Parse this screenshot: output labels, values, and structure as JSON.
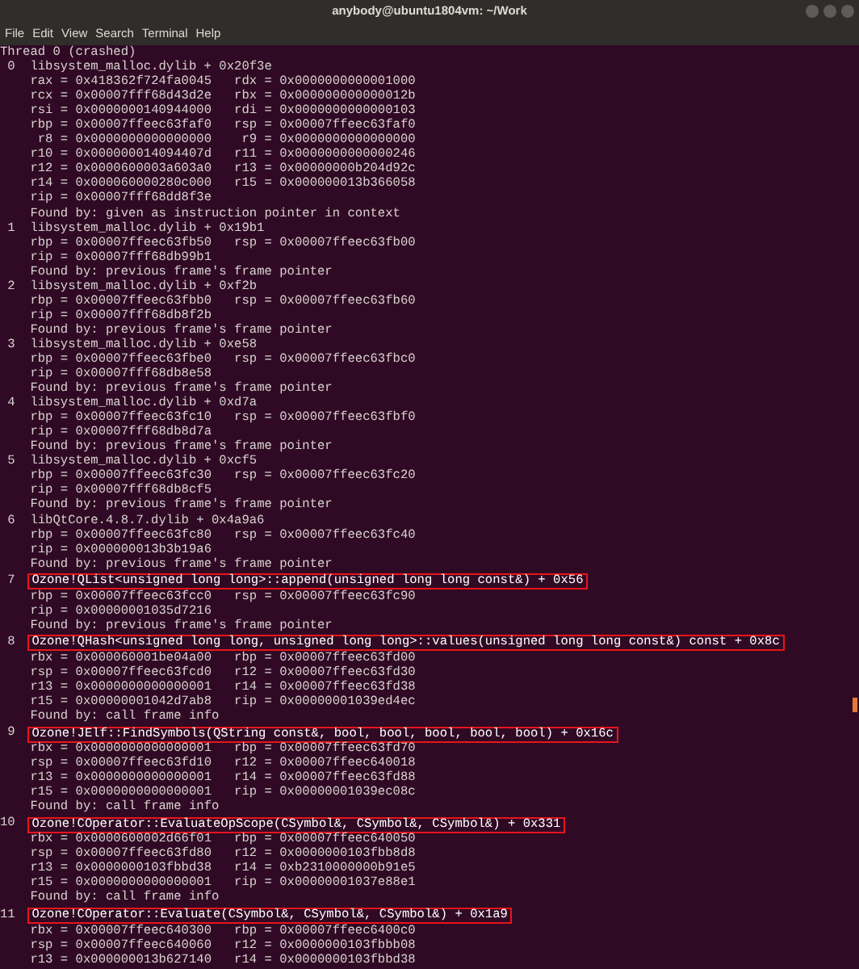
{
  "window": {
    "title": "anybody@ubuntu1804vm: ~/Work"
  },
  "menu": [
    "File",
    "Edit",
    "View",
    "Search",
    "Terminal",
    "Help"
  ],
  "lines": [
    {
      "kind": "plain",
      "text": "Thread 0 (crashed)"
    },
    {
      "kind": "frame",
      "number": "0",
      "text": "libsystem_malloc.dylib + 0x20f3e",
      "highlighted": false
    },
    {
      "kind": "detail",
      "text": "rax = 0x418362f724fa0045   rdx = 0x0000000000001000"
    },
    {
      "kind": "detail",
      "text": "rcx = 0x00007fff68d43d2e   rbx = 0x000000000000012b"
    },
    {
      "kind": "detail",
      "text": "rsi = 0x0000000140944000   rdi = 0x0000000000000103"
    },
    {
      "kind": "detail",
      "text": "rbp = 0x00007ffeec63faf0   rsp = 0x00007ffeec63faf0"
    },
    {
      "kind": "detail",
      "text": " r8 = 0x0000000000000000    r9 = 0x0000000000000000"
    },
    {
      "kind": "detail",
      "text": "r10 = 0x000000014094407d   r11 = 0x0000000000000246"
    },
    {
      "kind": "detail",
      "text": "r12 = 0x0000600003a603a0   r13 = 0x00000000b204d92c"
    },
    {
      "kind": "detail",
      "text": "r14 = 0x000060000280c000   r15 = 0x000000013b366058"
    },
    {
      "kind": "detail",
      "text": "rip = 0x00007fff68dd8f3e"
    },
    {
      "kind": "detail",
      "text": "Found by: given as instruction pointer in context"
    },
    {
      "kind": "frame",
      "number": "1",
      "text": "libsystem_malloc.dylib + 0x19b1",
      "highlighted": false
    },
    {
      "kind": "detail",
      "text": "rbp = 0x00007ffeec63fb50   rsp = 0x00007ffeec63fb00"
    },
    {
      "kind": "detail",
      "text": "rip = 0x00007fff68db99b1"
    },
    {
      "kind": "detail",
      "text": "Found by: previous frame's frame pointer"
    },
    {
      "kind": "frame",
      "number": "2",
      "text": "libsystem_malloc.dylib + 0xf2b",
      "highlighted": false
    },
    {
      "kind": "detail",
      "text": "rbp = 0x00007ffeec63fbb0   rsp = 0x00007ffeec63fb60"
    },
    {
      "kind": "detail",
      "text": "rip = 0x00007fff68db8f2b"
    },
    {
      "kind": "detail",
      "text": "Found by: previous frame's frame pointer"
    },
    {
      "kind": "frame",
      "number": "3",
      "text": "libsystem_malloc.dylib + 0xe58",
      "highlighted": false
    },
    {
      "kind": "detail",
      "text": "rbp = 0x00007ffeec63fbe0   rsp = 0x00007ffeec63fbc0"
    },
    {
      "kind": "detail",
      "text": "rip = 0x00007fff68db8e58"
    },
    {
      "kind": "detail",
      "text": "Found by: previous frame's frame pointer"
    },
    {
      "kind": "frame",
      "number": "4",
      "text": "libsystem_malloc.dylib + 0xd7a",
      "highlighted": false
    },
    {
      "kind": "detail",
      "text": "rbp = 0x00007ffeec63fc10   rsp = 0x00007ffeec63fbf0"
    },
    {
      "kind": "detail",
      "text": "rip = 0x00007fff68db8d7a"
    },
    {
      "kind": "detail",
      "text": "Found by: previous frame's frame pointer"
    },
    {
      "kind": "frame",
      "number": "5",
      "text": "libsystem_malloc.dylib + 0xcf5",
      "highlighted": false
    },
    {
      "kind": "detail",
      "text": "rbp = 0x00007ffeec63fc30   rsp = 0x00007ffeec63fc20"
    },
    {
      "kind": "detail",
      "text": "rip = 0x00007fff68db8cf5"
    },
    {
      "kind": "detail",
      "text": "Found by: previous frame's frame pointer"
    },
    {
      "kind": "frame",
      "number": "6",
      "text": "libQtCore.4.8.7.dylib + 0x4a9a6",
      "highlighted": false
    },
    {
      "kind": "detail",
      "text": "rbp = 0x00007ffeec63fc80   rsp = 0x00007ffeec63fc40"
    },
    {
      "kind": "detail",
      "text": "rip = 0x000000013b3b19a6"
    },
    {
      "kind": "detail",
      "text": "Found by: previous frame's frame pointer"
    },
    {
      "kind": "frame",
      "number": "7",
      "text": "Ozone!QList<unsigned long long>::append(unsigned long long const&) + 0x56",
      "highlighted": true
    },
    {
      "kind": "detail",
      "text": "rbp = 0x00007ffeec63fcc0   rsp = 0x00007ffeec63fc90"
    },
    {
      "kind": "detail",
      "text": "rip = 0x00000001035d7216"
    },
    {
      "kind": "detail",
      "text": "Found by: previous frame's frame pointer"
    },
    {
      "kind": "frame",
      "number": "8",
      "text": "Ozone!QHash<unsigned long long, unsigned long long>::values(unsigned long long const&) const + 0x8c",
      "highlighted": true
    },
    {
      "kind": "detail",
      "text": "rbx = 0x000060001be04a00   rbp = 0x00007ffeec63fd00"
    },
    {
      "kind": "detail",
      "text": "rsp = 0x00007ffeec63fcd0   r12 = 0x00007ffeec63fd30"
    },
    {
      "kind": "detail",
      "text": "r13 = 0x0000000000000001   r14 = 0x00007ffeec63fd38"
    },
    {
      "kind": "detail",
      "text": "r15 = 0x00000001042d7ab8   rip = 0x00000001039ed4ec"
    },
    {
      "kind": "detail",
      "text": "Found by: call frame info"
    },
    {
      "kind": "frame",
      "number": "9",
      "text": "Ozone!JElf::FindSymbols(QString const&, bool, bool, bool, bool, bool) + 0x16c",
      "highlighted": true
    },
    {
      "kind": "detail",
      "text": "rbx = 0x0000000000000001   rbp = 0x00007ffeec63fd70"
    },
    {
      "kind": "detail",
      "text": "rsp = 0x00007ffeec63fd10   r12 = 0x00007ffeec640018"
    },
    {
      "kind": "detail",
      "text": "r13 = 0x0000000000000001   r14 = 0x00007ffeec63fd88"
    },
    {
      "kind": "detail",
      "text": "r15 = 0x0000000000000001   rip = 0x00000001039ec08c"
    },
    {
      "kind": "detail",
      "text": "Found by: call frame info"
    },
    {
      "kind": "frame",
      "number": "10",
      "text": "Ozone!COperator::EvaluateOpScope(CSymbol&, CSymbol&, CSymbol&) + 0x331",
      "highlighted": true
    },
    {
      "kind": "detail",
      "text": "rbx = 0x0000600002d66f01   rbp = 0x00007ffeec640050"
    },
    {
      "kind": "detail",
      "text": "rsp = 0x00007ffeec63fd80   r12 = 0x0000000103fbb8d8"
    },
    {
      "kind": "detail",
      "text": "r13 = 0x0000000103fbbd38   r14 = 0xb2310000000b91e5"
    },
    {
      "kind": "detail",
      "text": "r15 = 0x0000000000000001   rip = 0x00000001037e88e1"
    },
    {
      "kind": "detail",
      "text": "Found by: call frame info"
    },
    {
      "kind": "frame",
      "number": "11",
      "text": "Ozone!COperator::Evaluate(CSymbol&, CSymbol&, CSymbol&) + 0x1a9",
      "highlighted": true
    },
    {
      "kind": "detail",
      "text": "rbx = 0x00007ffeec640300   rbp = 0x00007ffeec6400c0"
    },
    {
      "kind": "detail",
      "text": "rsp = 0x00007ffeec640060   r12 = 0x0000000103fbbb08"
    },
    {
      "kind": "detail",
      "text": "r13 = 0x000000013b627140   r14 = 0x0000000103fbbd38"
    }
  ]
}
